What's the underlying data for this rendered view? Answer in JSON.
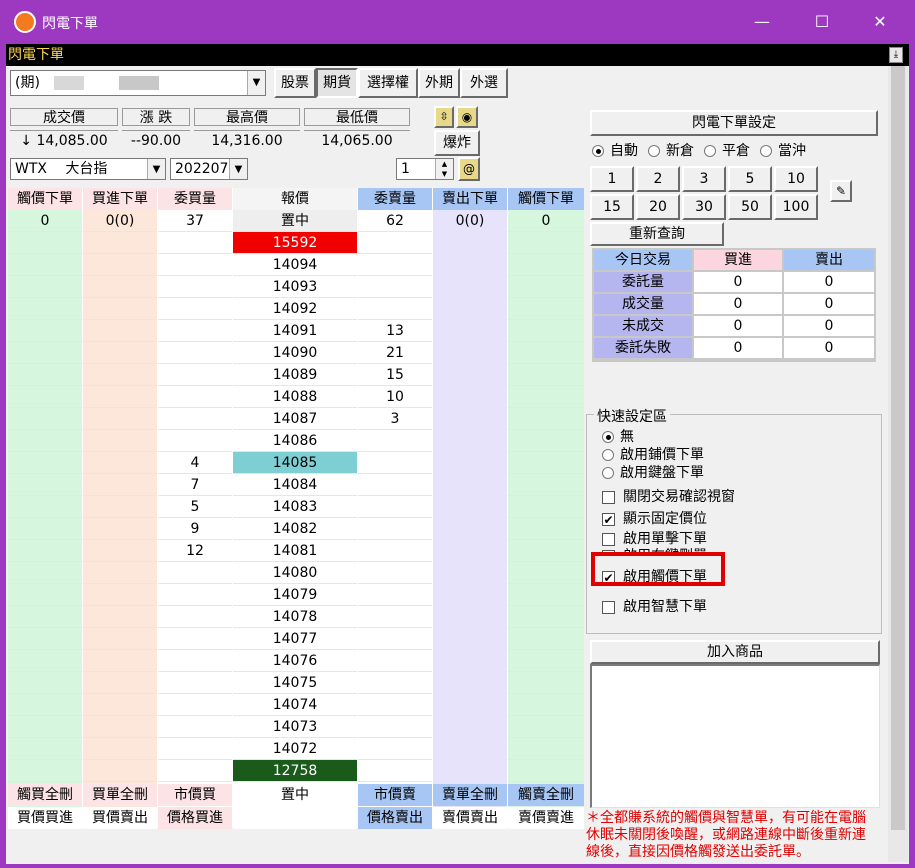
{
  "window": {
    "title": "閃電下單",
    "subtitle": "閃電下單",
    "pin": "⤓",
    "min": "—",
    "max": "☐",
    "close": "✕"
  },
  "toolbar": {
    "account_label": "(期)",
    "tabs": [
      "股票",
      "期貨",
      "選擇權",
      "外期",
      "外選"
    ]
  },
  "quote": {
    "labels": [
      "成交價",
      "漲 跌",
      "最高價",
      "最低價"
    ],
    "values": [
      "↓ 14,085.00",
      "--90.00",
      "14,316.00",
      "14,065.00"
    ],
    "blast_label": "爆炸",
    "symbol": "WTX　 大台指",
    "month": "202207",
    "qty": "1"
  },
  "grid": {
    "headers": [
      "觸價下單",
      "買進下單",
      "委買量",
      "報價",
      "委賣量",
      "賣出下單",
      "觸價下單"
    ],
    "first_row": [
      "0",
      "0(0)",
      "37",
      "置中",
      "62",
      "0(0)",
      "0"
    ],
    "prices": [
      "15592",
      "14094",
      "14093",
      "14092",
      "14091",
      "14090",
      "14089",
      "14088",
      "14087",
      "14086",
      "14085",
      "14084",
      "14083",
      "14082",
      "14081",
      "14080",
      "14079",
      "14078",
      "14077",
      "14076",
      "14075",
      "14074",
      "14073",
      "14072",
      "12758"
    ],
    "bid_qty": [
      "",
      "",
      "",
      "",
      "",
      "",
      "",
      "",
      "",
      "",
      "4",
      "7",
      "5",
      "9",
      "12",
      "",
      "",
      "",
      "",
      "",
      "",
      "",
      "",
      "",
      ""
    ],
    "ask_qty": [
      "",
      "",
      "",
      "",
      "13",
      "21",
      "15",
      "10",
      "3",
      "",
      "",
      "",
      "",
      "",
      "",
      "",
      "",
      "",
      "",
      "",
      "",
      "",
      "",
      "",
      ""
    ],
    "footer1": [
      "觸買全刪",
      "買單全刪",
      "市價買",
      "置中",
      "市價賣",
      "賣單全刪",
      "觸賣全刪"
    ],
    "footer2": [
      "買價買進",
      "買價賣出",
      "價格買進",
      "",
      "價格賣出",
      "賣價賣出",
      "賣價賣進"
    ]
  },
  "right": {
    "settings_button": "閃電下單設定",
    "position_modes": [
      "自動",
      "新倉",
      "平倉",
      "當沖"
    ],
    "qty_row1": [
      "1",
      "2",
      "3",
      "5",
      "10"
    ],
    "qty_row2": [
      "15",
      "20",
      "30",
      "50",
      "100"
    ],
    "requery": "重新查詢",
    "summary_headers": [
      "今日交易",
      "買進",
      "賣出"
    ],
    "summary_rows": [
      {
        "label": "委託量",
        "buy": "0",
        "sell": "0"
      },
      {
        "label": "成交量",
        "buy": "0",
        "sell": "0"
      },
      {
        "label": "未成交",
        "buy": "0",
        "sell": "0"
      },
      {
        "label": "委託失敗",
        "buy": "0",
        "sell": "0"
      }
    ],
    "quick_title": "快速設定區",
    "quick_radios": [
      "無",
      "啟用鋪價下單",
      "啟用鍵盤下單"
    ],
    "quick_checks": [
      {
        "label": "關閉交易確認視窗",
        "checked": ""
      },
      {
        "label": "顯示固定價位",
        "checked": "✔"
      },
      {
        "label": "啟用單擊下單",
        "checked": ""
      },
      {
        "label": "啟用右鍵刪單",
        "checked": ""
      },
      {
        "label": "啟用觸價下單",
        "checked": "✔"
      },
      {
        "label": "啟用智慧下單",
        "checked": ""
      }
    ],
    "add_product": "加入商品",
    "warning": "＊全都賺系統的觸價與智慧單，有可能在電腦休眠未關閉後喚醒，或網路連線中斷後重新連線後，直接因價格觸發送出委託單。"
  },
  "colors": {
    "last_price_bg": "#7ecfd3",
    "top_price_bg": "#f00000",
    "bottom_price_bg": "#1a5a1a",
    "highlight": "#e00000"
  }
}
